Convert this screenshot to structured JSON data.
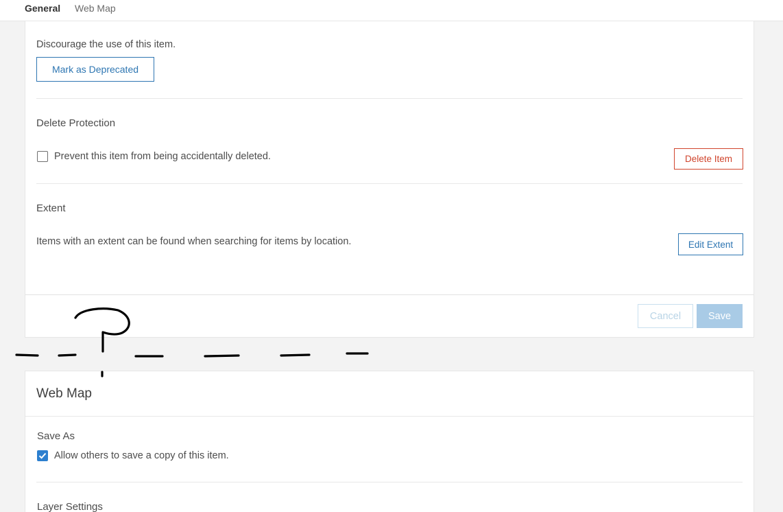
{
  "tabs": [
    {
      "label": "General",
      "active": true
    },
    {
      "label": "Web Map",
      "active": false
    }
  ],
  "deprecate": {
    "description": "Discourage the use of this item.",
    "button_label": "Mark as Deprecated"
  },
  "delete_protection": {
    "heading": "Delete Protection",
    "checkbox_label": "Prevent this item from being accidentally deleted.",
    "checked": false,
    "button_label": "Delete Item"
  },
  "extent": {
    "heading": "Extent",
    "description": "Items with an extent can be found when searching for items by location.",
    "button_label": "Edit Extent"
  },
  "footer": {
    "cancel_label": "Cancel",
    "save_label": "Save"
  },
  "web_map": {
    "title": "Web Map",
    "save_as_heading": "Save As",
    "save_as_checkbox_label": "Allow others to save a copy of this item.",
    "save_as_checked": true,
    "layer_settings_heading": "Layer Settings"
  },
  "colors": {
    "accent": "#2e76b2",
    "danger": "#d0442c",
    "checkbox_checked": "#2c7fcf",
    "disabled_primary": "#a9cbe6"
  },
  "icons": {
    "checkmark": "check-icon"
  }
}
